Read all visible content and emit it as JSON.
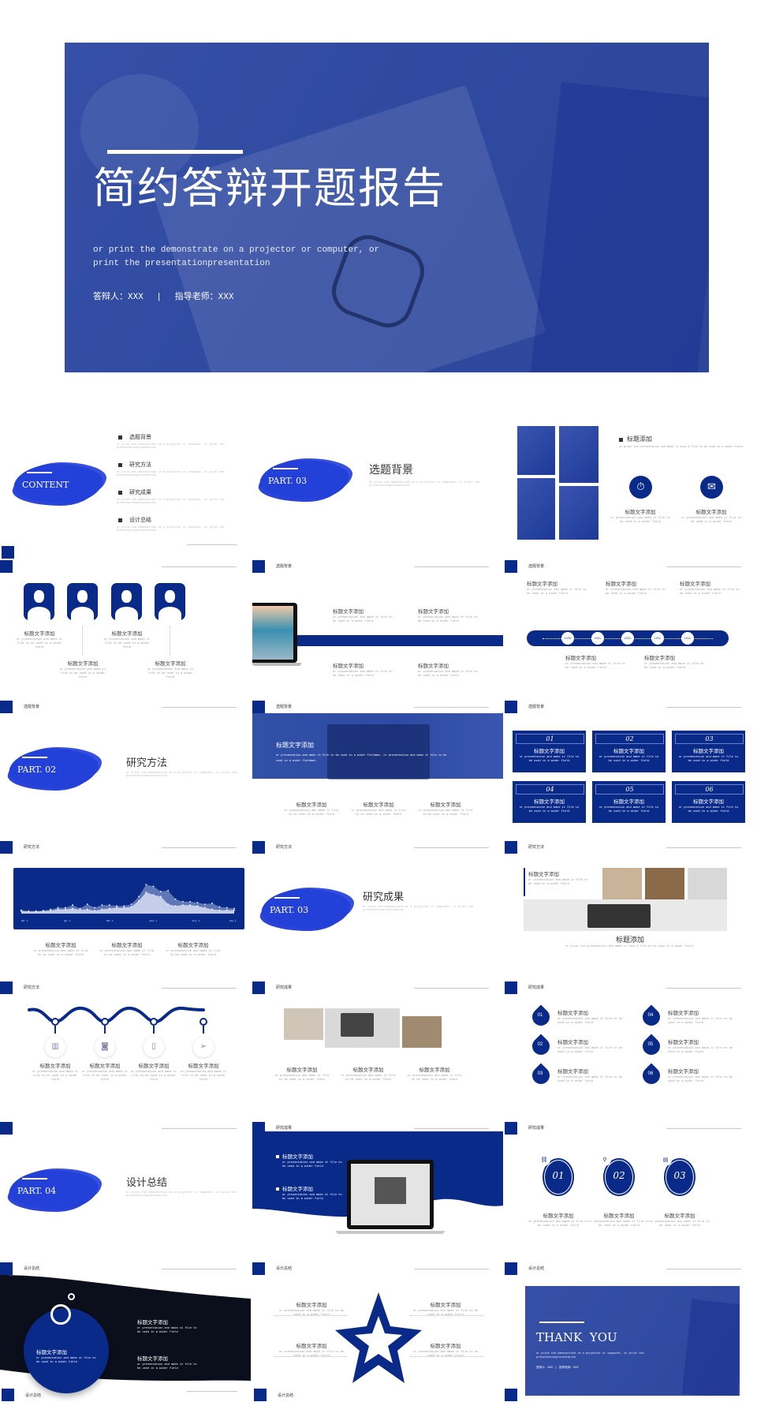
{
  "theme": {
    "primary": "#0a2a8a",
    "cover_blue": "#2f4aa0",
    "brush_blue": "#2340d8",
    "dark": "#0b0f1c"
  },
  "common": {
    "heading": "标题文字添加",
    "body": "or presentation and make it file to be used in a wider field",
    "long": "or print the demonstrate on a projector or computer, or print the presentationpresentation",
    "title_add": "标题添加",
    "title_add_desc": "or print the presentation and make it into a file to be used in a wider field."
  },
  "cover": {
    "title": "简约答辩开题报告",
    "subtitle": "or print the demonstrate on a projector or computer, or print the presentationpresentation",
    "presenter": "答辩人：XXX",
    "separator": "|",
    "advisor": "指导老师：XXX"
  },
  "headers": [
    [
      "",
      "",
      ""
    ],
    [
      "",
      "选题背景",
      "选题背景"
    ],
    [
      "选题背景",
      "选题背景",
      "选题背景"
    ],
    [
      "研究方法",
      "研究方法",
      "研究方法"
    ],
    [
      "研究方法",
      "研究成果",
      "研究成果"
    ],
    [
      "",
      "研究成果",
      "研究成果"
    ],
    [
      "设计总结",
      "设计总结",
      "设计总结"
    ]
  ],
  "footers": [
    "设计总结",
    "设计总结",
    ""
  ],
  "contents": {
    "brush": "CONTENT",
    "items": [
      "选题背景",
      "研究方法",
      "研究成果",
      "设计总结"
    ]
  },
  "sections": [
    {
      "brush": "PART. 03",
      "title": "选题背景"
    },
    {
      "brush": "PART. 02",
      "title": "研究方法"
    },
    {
      "brush": "PART. 03",
      "title": "研究成果"
    },
    {
      "brush": "PART. 04",
      "title": "设计总结"
    }
  ],
  "feature_icons": [
    "clock-dollar-icon",
    "mail-icon"
  ],
  "timeline": {
    "years": [
      "2016",
      "2022",
      "2022",
      "2022",
      "2022"
    ]
  },
  "banner": {
    "text": "or presentation and make it file to be used in a wider fieldmat. or presentation and make it file to be used in a wider fieldmat."
  },
  "cards": [
    "01",
    "02",
    "03",
    "04",
    "05",
    "06"
  ],
  "chart_data": {
    "type": "area",
    "categories": [
      "Mar 1",
      "Apr 1",
      "May 1",
      "June 1",
      "July 1",
      "Aug 1"
    ],
    "ylim": [
      0,
      100
    ],
    "grid": false,
    "series": [
      {
        "values": [
          8,
          6,
          6,
          7,
          10,
          14,
          14,
          20,
          12,
          22,
          14,
          20,
          20,
          18,
          18,
          22,
          40,
          68,
          64,
          52,
          54,
          34,
          28,
          28,
          26,
          22,
          24,
          16,
          14,
          12
        ]
      },
      {
        "values": [
          6,
          5,
          5,
          6,
          7,
          10,
          10,
          12,
          9,
          10,
          7,
          10,
          12,
          14,
          14,
          16,
          30,
          50,
          44,
          40,
          22,
          18,
          20,
          20,
          18,
          14,
          10,
          8,
          8,
          8
        ]
      }
    ]
  },
  "wave_icons": [
    "building-icon",
    "camera-icon",
    "phone-icon",
    "paper-plane-icon"
  ],
  "half_circles": [
    "01",
    "02",
    "03",
    "04",
    "05",
    "06"
  ],
  "circles": [
    {
      "num": "01",
      "icon": "link-icon"
    },
    {
      "num": "02",
      "icon": "bicycle-icon"
    },
    {
      "num": "03",
      "icon": "document-icon"
    }
  ],
  "thanks": {
    "title": "THANK  YOU",
    "subtitle": "or print the demonstrate on a projector or computer, or print the presentationpresentation",
    "presenter": "答辩人：XXX",
    "separator": "|",
    "advisor": "指导老师：XXX"
  }
}
